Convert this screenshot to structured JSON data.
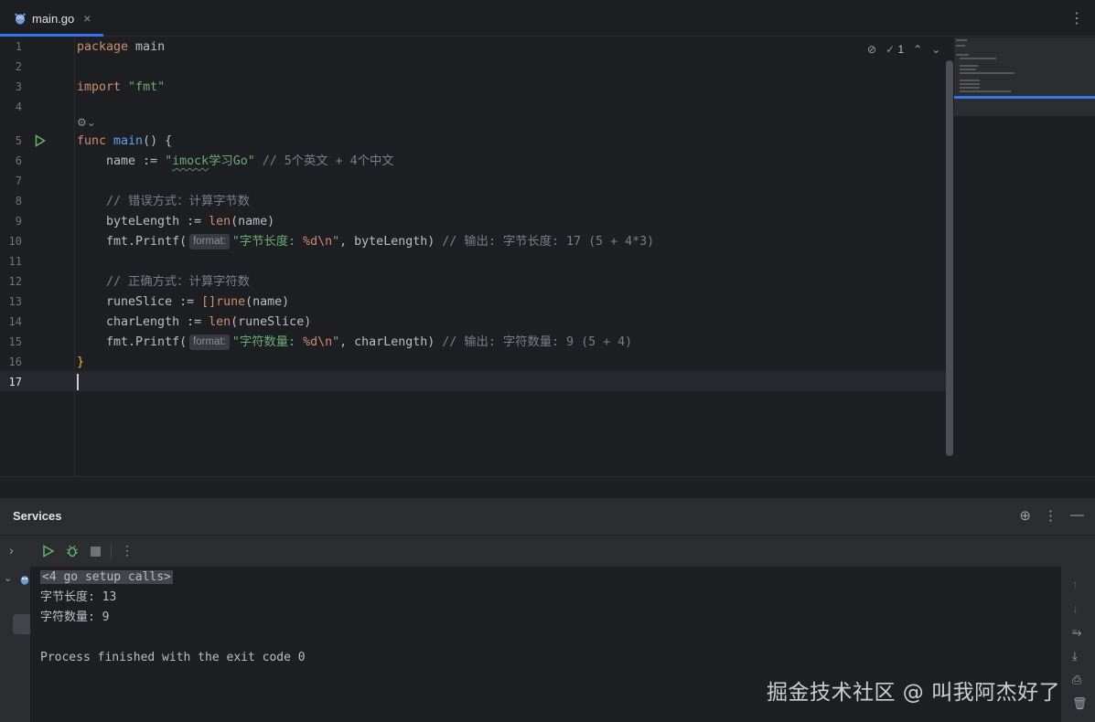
{
  "tab": {
    "filename": "main.go",
    "close_glyph": "×",
    "more_glyph": "⋮"
  },
  "inspections": {
    "count": "1"
  },
  "gutter": {
    "line_numbers": [
      "1",
      "2",
      "3",
      "4",
      "5",
      "6",
      "7",
      "8",
      "9",
      "10",
      "11",
      "12",
      "13",
      "14",
      "15",
      "16",
      "17"
    ],
    "current_line": "17"
  },
  "code": {
    "l1_kw": "package",
    "l1_name": " main",
    "l3_kw": "import",
    "l3_str": " \"fmt\"",
    "l5_kw": "func",
    "l5_fn": " main",
    "l5_rest": "() {",
    "l6_a": "    name := ",
    "l6_str_a": "\"",
    "l6_str_b": "imock",
    "l6_str_c": "学习Go\"",
    "l6_cmt": " // 5个英文 + 4个中文",
    "l8_cmt": "    // 错误方式：计算字节数",
    "l9_a": "    byteLength := ",
    "l9_builtin": "len",
    "l9_b": "(name)",
    "l10_a": "    fmt.Printf(",
    "l10_hint": "format:",
    "l10_str_a": "\"字节长度: ",
    "l10_verb": "%d\\n",
    "l10_str_b": "\"",
    "l10_b": ", byteLength) ",
    "l10_cmt": "// 输出: 字节长度: 17 (5 + 4*3)",
    "l12_cmt": "    // 正确方式：计算字符数",
    "l13_a": "    runeSlice := ",
    "l13_b": "[]",
    "l13_builtin": "rune",
    "l13_c": "(name)",
    "l14_a": "    charLength := ",
    "l14_builtin": "len",
    "l14_b": "(runeSlice)",
    "l15_a": "    fmt.Printf(",
    "l15_hint": "format:",
    "l15_str_a": "\"字符数量: ",
    "l15_verb": "%d\\n",
    "l15_str_b": "\"",
    "l15_b": ", charLength) ",
    "l15_cmt": "// 输出: 字符数量: 9 (5 + 4)",
    "l16": "}"
  },
  "services": {
    "title": "Services",
    "console_lines": [
      "<4 go setup calls>",
      "字节长度: 13",
      "字符数量: 9",
      "",
      "Process finished with the exit code 0"
    ]
  },
  "watermark": "掘金技术社区 @ 叫我阿杰好了",
  "colors": {
    "accent": "#3574f0",
    "run_green": "#5fb865",
    "keyword": "#cf8e6d",
    "string": "#6aab73",
    "comment": "#7a7e85",
    "function": "#56a8f5"
  },
  "icons": [
    "gopher-icon",
    "close-icon",
    "more-vert-icon",
    "eye-slash-icon",
    "check-icon",
    "chevron-up-icon",
    "chevron-down-icon",
    "run-icon",
    "debug-icon",
    "stop-icon",
    "target-icon",
    "minimize-icon",
    "expand-icon",
    "arrow-up-icon",
    "arrow-down-icon",
    "soft-wrap-icon",
    "scroll-end-icon",
    "print-icon",
    "trash-icon",
    "code-lens-icon"
  ]
}
